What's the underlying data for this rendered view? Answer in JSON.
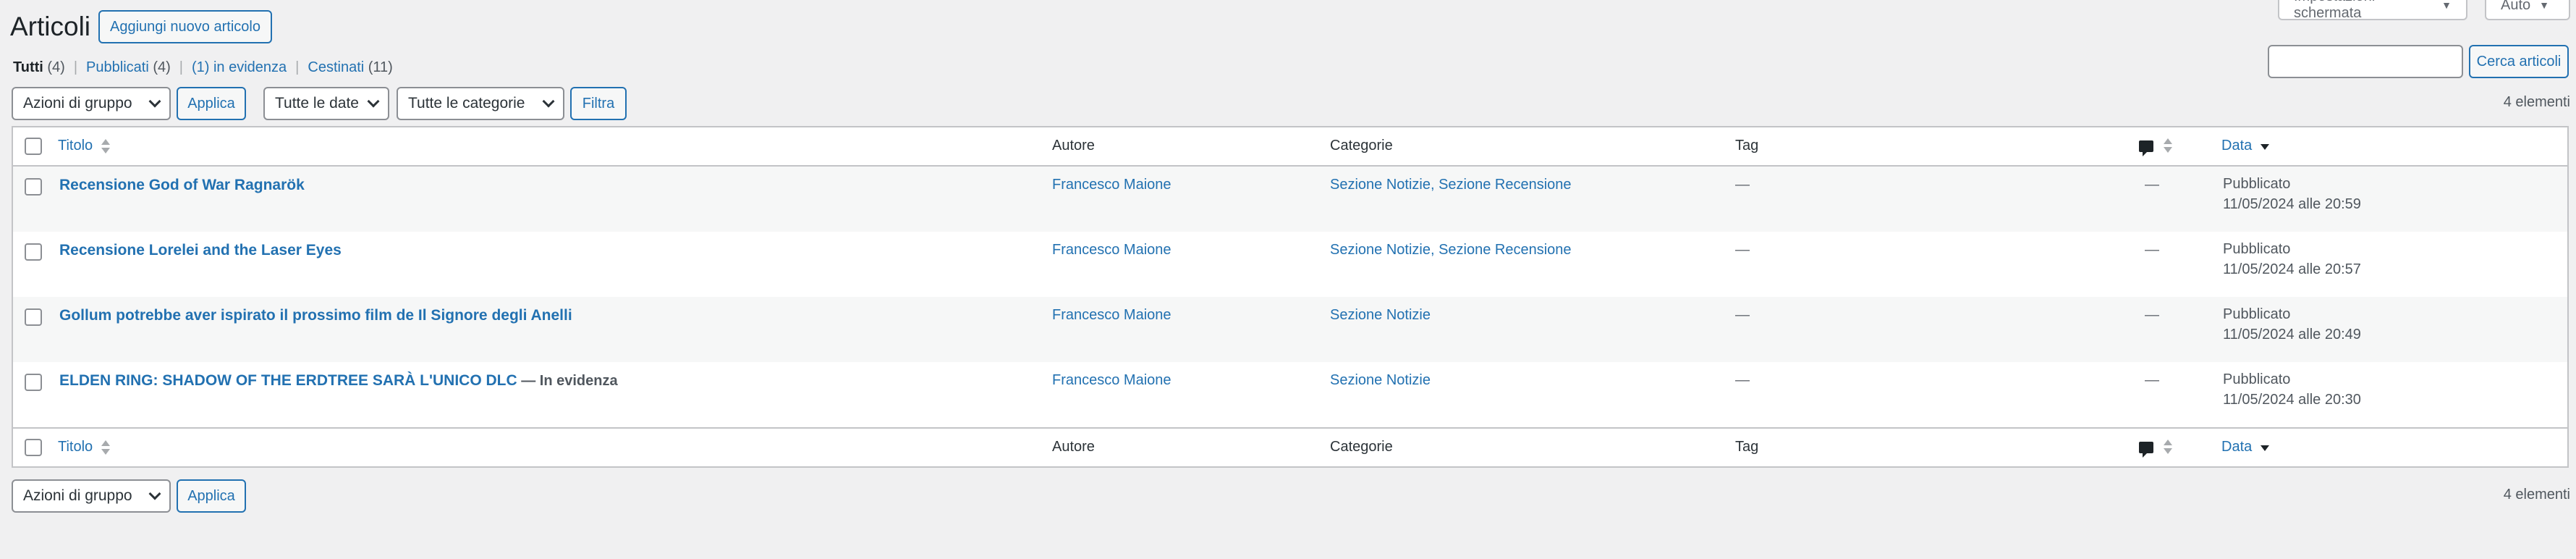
{
  "screen_tabs": {
    "screen_options": "Impostazioni schermata",
    "auto": "Auto"
  },
  "header": {
    "title": "Articoli",
    "add_new": "Aggiungi nuovo articolo"
  },
  "views": [
    {
      "label": "Tutti",
      "count": "(4)"
    },
    {
      "label": "Pubblicati",
      "count": "(4)"
    },
    {
      "label": "(1) in evidenza",
      "count": ""
    },
    {
      "label": "Cestinati",
      "count": "(11)"
    }
  ],
  "search": {
    "button": "Cerca articoli",
    "value": ""
  },
  "filters": {
    "bulk_actions": "Azioni di gruppo",
    "apply": "Applica",
    "dates": "Tutte le date",
    "categories": "Tutte le categorie",
    "filter": "Filtra"
  },
  "items_count": "4 elementi",
  "columns": {
    "title": "Titolo",
    "author": "Autore",
    "categories": "Categorie",
    "tags": "Tag",
    "date": "Data"
  },
  "posts": [
    {
      "title": "Recensione God of War Ragnarök",
      "state": "",
      "author": "Francesco Maione",
      "categories": "Sezione Notizie, Sezione Recensione",
      "tags": "—",
      "comments": "—",
      "status": "Pubblicato",
      "date": "11/05/2024 alle 20:59"
    },
    {
      "title": "Recensione Lorelei and the Laser Eyes",
      "state": "",
      "author": "Francesco Maione",
      "categories": "Sezione Notizie, Sezione Recensione",
      "tags": "—",
      "comments": "—",
      "status": "Pubblicato",
      "date": "11/05/2024 alle 20:57"
    },
    {
      "title": "Gollum potrebbe aver ispirato il prossimo film de Il Signore degli Anelli",
      "state": "",
      "author": "Francesco Maione",
      "categories": "Sezione Notizie",
      "tags": "—",
      "comments": "—",
      "status": "Pubblicato",
      "date": "11/05/2024 alle 20:49"
    },
    {
      "title": "ELDEN RING: SHADOW OF THE ERDTREE SARÀ L'UNICO DLC",
      "state": "— In evidenza",
      "author": "Francesco Maione",
      "categories": "Sezione Notizie",
      "tags": "—",
      "comments": "—",
      "status": "Pubblicato",
      "date": "11/05/2024 alle 20:30"
    }
  ],
  "icons": {
    "comment": "comment-bubble-icon",
    "sort": "sort-arrows-icon",
    "dropdown": "chevron-down-icon"
  },
  "colors": {
    "link": "#2271b1",
    "background": "#f0f0f1",
    "border": "#c3c4c7"
  }
}
